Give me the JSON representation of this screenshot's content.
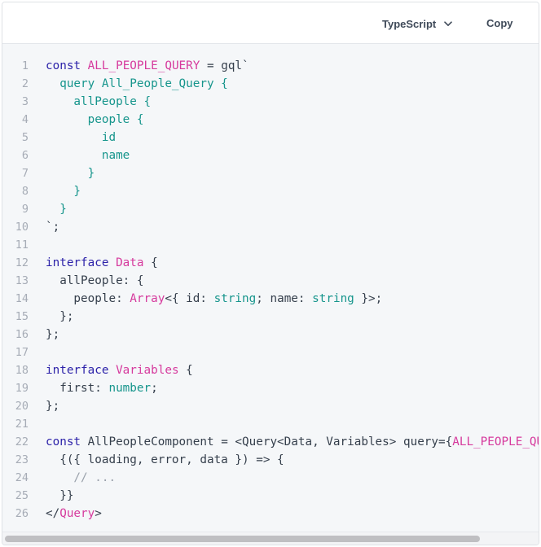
{
  "toolbar": {
    "language": "TypeScript",
    "copy_label": "Copy"
  },
  "code_lines": [
    {
      "n": "1",
      "tokens": [
        [
          "kw",
          "const"
        ],
        [
          "t",
          " "
        ],
        [
          "var",
          "ALL_PEOPLE_QUERY"
        ],
        [
          "t",
          " = gql`"
        ]
      ]
    },
    {
      "n": "2",
      "tokens": [
        [
          "gql",
          "  query All_People_Query {"
        ]
      ]
    },
    {
      "n": "3",
      "tokens": [
        [
          "gql",
          "    allPeople {"
        ]
      ]
    },
    {
      "n": "4",
      "tokens": [
        [
          "gql",
          "      people {"
        ]
      ]
    },
    {
      "n": "5",
      "tokens": [
        [
          "gql",
          "        id"
        ]
      ]
    },
    {
      "n": "6",
      "tokens": [
        [
          "gql",
          "        name"
        ]
      ]
    },
    {
      "n": "7",
      "tokens": [
        [
          "gql",
          "      }"
        ]
      ]
    },
    {
      "n": "8",
      "tokens": [
        [
          "gql",
          "    }"
        ]
      ]
    },
    {
      "n": "9",
      "tokens": [
        [
          "gql",
          "  }"
        ]
      ]
    },
    {
      "n": "10",
      "tokens": [
        [
          "t",
          "`;"
        ]
      ]
    },
    {
      "n": "11",
      "tokens": []
    },
    {
      "n": "12",
      "tokens": [
        [
          "kw",
          "interface"
        ],
        [
          "t",
          " "
        ],
        [
          "var",
          "Data"
        ],
        [
          "t",
          " {"
        ]
      ]
    },
    {
      "n": "13",
      "tokens": [
        [
          "t",
          "  allPeople: {"
        ]
      ]
    },
    {
      "n": "14",
      "tokens": [
        [
          "t",
          "    people: "
        ],
        [
          "var",
          "Array"
        ],
        [
          "t",
          "<{ id: "
        ],
        [
          "type",
          "string"
        ],
        [
          "t",
          "; name: "
        ],
        [
          "type",
          "string"
        ],
        [
          "t",
          " }>;"
        ]
      ]
    },
    {
      "n": "15",
      "tokens": [
        [
          "t",
          "  };"
        ]
      ]
    },
    {
      "n": "16",
      "tokens": [
        [
          "t",
          "};"
        ]
      ]
    },
    {
      "n": "17",
      "tokens": []
    },
    {
      "n": "18",
      "tokens": [
        [
          "kw",
          "interface"
        ],
        [
          "t",
          " "
        ],
        [
          "var",
          "Variables"
        ],
        [
          "t",
          " {"
        ]
      ]
    },
    {
      "n": "19",
      "tokens": [
        [
          "t",
          "  first: "
        ],
        [
          "type",
          "number"
        ],
        [
          "t",
          ";"
        ]
      ]
    },
    {
      "n": "20",
      "tokens": [
        [
          "t",
          "};"
        ]
      ]
    },
    {
      "n": "21",
      "tokens": []
    },
    {
      "n": "22",
      "tokens": [
        [
          "kw",
          "const"
        ],
        [
          "t",
          " AllPeopleComponent = <Query<Data, Variables> query={"
        ],
        [
          "var",
          "ALL_PEOPLE_QUERY"
        ],
        [
          "t",
          "}>"
        ]
      ]
    },
    {
      "n": "23",
      "tokens": [
        [
          "t",
          "  {({ loading, error, data }) => {"
        ]
      ]
    },
    {
      "n": "24",
      "tokens": [
        [
          "comment",
          "    // ..."
        ]
      ]
    },
    {
      "n": "25",
      "tokens": [
        [
          "t",
          "  }}"
        ]
      ]
    },
    {
      "n": "26",
      "tokens": [
        [
          "t",
          "</"
        ],
        [
          "var",
          "Query"
        ],
        [
          "t",
          ">"
        ]
      ]
    }
  ]
}
